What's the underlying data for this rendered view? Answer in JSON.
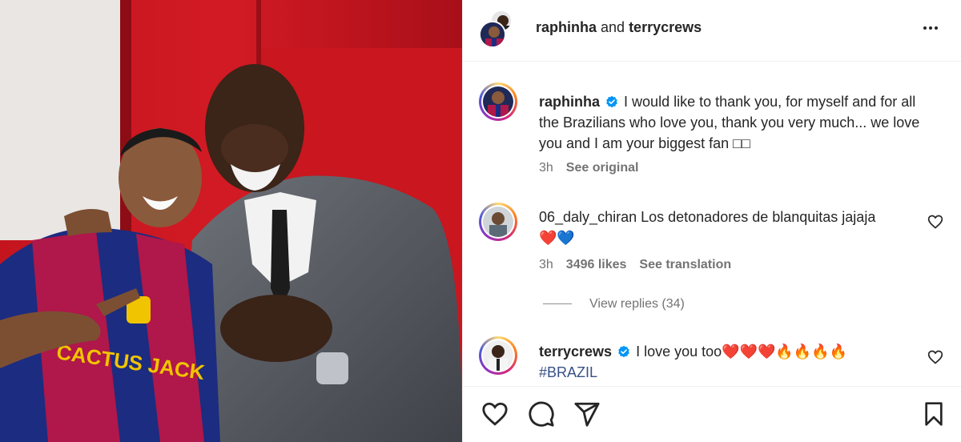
{
  "post": {
    "photo_alt": "raphinha and terrycrews photo",
    "jersey_text": "CACTUS JACK"
  },
  "header": {
    "user1": "raphinha",
    "connector": " and ",
    "user2": "terrycrews"
  },
  "caption": {
    "username": "raphinha",
    "text": "I would like to thank you, for myself and for all the Brazilians who love you, thank you very much... we love you and I am your biggest fan □□",
    "time": "3h",
    "see_original": "See original"
  },
  "comments": [
    {
      "username": "06_daly_chiran",
      "text": "Los detonadores de blanquitas jajaja",
      "emoji": "❤️💙",
      "time": "3h",
      "likes": "3496 likes",
      "action": "See translation"
    },
    {
      "username": "terrycrews",
      "text": "I love you too❤️❤️❤️🔥🔥🔥🔥",
      "hashtag": "#BRAZIL"
    }
  ],
  "replies": {
    "label": "View replies (34)"
  },
  "colors": {
    "verified": "#0095f6",
    "accent_red": "#b3121c",
    "text_secondary": "#737373"
  },
  "icons": {
    "more": "more-options-icon",
    "like": "heart-icon",
    "comment": "comment-icon",
    "share": "send-icon",
    "save": "bookmark-icon"
  }
}
